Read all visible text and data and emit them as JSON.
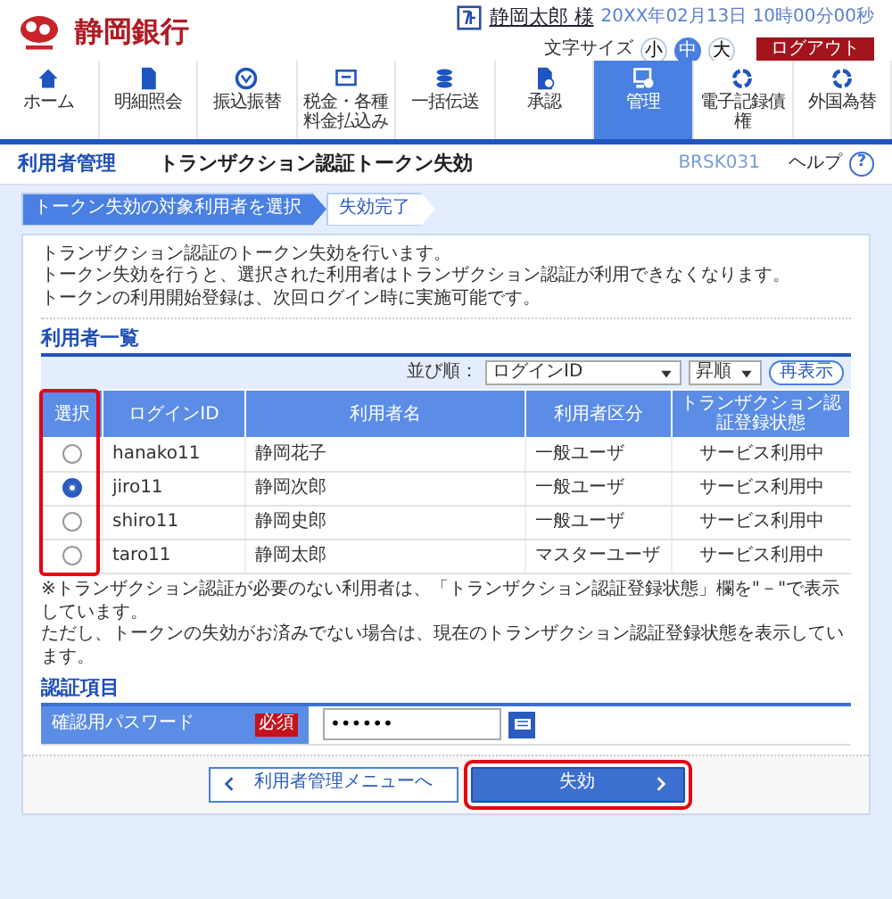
{
  "header": {
    "bank_name": "静岡銀行",
    "user_name": "静岡太郎 様",
    "datetime": "20XX年02月13日 10時00分00秒",
    "font_size_label": "文字サイズ",
    "font_sizes": [
      {
        "label": "小",
        "selected": false
      },
      {
        "label": "中",
        "selected": true
      },
      {
        "label": "大",
        "selected": false
      }
    ],
    "logout": "ログアウト"
  },
  "nav": [
    {
      "label": "ホーム",
      "kind": "home",
      "selected": false
    },
    {
      "label": "明細照会",
      "kind": "document",
      "selected": false
    },
    {
      "label": "振込振替",
      "kind": "transfer",
      "selected": false
    },
    {
      "label": "税金・各種料金払込み",
      "kind": "bill",
      "selected": false
    },
    {
      "label": "一括伝送",
      "kind": "stack",
      "selected": false
    },
    {
      "label": "承認",
      "kind": "approve",
      "selected": false
    },
    {
      "label": "管理",
      "kind": "admin",
      "selected": true
    },
    {
      "label": "電子記録債権",
      "kind": "ring",
      "selected": false
    },
    {
      "label": "外国為替",
      "kind": "ring",
      "selected": false
    }
  ],
  "page": {
    "category": "利用者管理",
    "title": "トランザクション認証トークン失効",
    "screen_id": "BRSK031",
    "help": "ヘルプ",
    "help_icon": "?"
  },
  "steps": [
    {
      "label": "トークン失効の対象利用者を選択",
      "selected": true
    },
    {
      "label": "失効完了",
      "selected": false
    }
  ],
  "intro": [
    "トランザクション認証のトークン失効を行います。",
    "トークン失効を行うと、選択された利用者はトランザクション認証が利用できなくなります。",
    "トークンの利用開始登録は、次回ログイン時に実施可能です。"
  ],
  "user_list": {
    "heading": "利用者一覧",
    "sort_label": "並び順：",
    "sort_field": "ログインID",
    "sort_order": "昇順",
    "redisplay": "再表示",
    "columns": [
      "選択",
      "ログインID",
      "利用者名",
      "利用者区分",
      "トランザクション認証登録状態"
    ],
    "select_column_highlighted": true,
    "rows": [
      {
        "login_id": "hanako11",
        "name": "静岡花子",
        "user_type": "一般ユーザ",
        "status": "サービス利用中",
        "selected": false
      },
      {
        "login_id": "jiro11",
        "name": "静岡次郎",
        "user_type": "一般ユーザ",
        "status": "サービス利用中",
        "selected": true
      },
      {
        "login_id": "shiro11",
        "name": "静岡史郎",
        "user_type": "一般ユーザ",
        "status": "サービス利用中",
        "selected": false
      },
      {
        "login_id": "taro11",
        "name": "静岡太郎",
        "user_type": "マスターユーザ",
        "status": "サービス利用中",
        "selected": false
      }
    ]
  },
  "notes": [
    "※トランザクション認証が必要のない利用者は、「トランザクション認証登録状態」欄を\"－\"で表示しています。",
    "ただし、トークンの失効がお済みでない場合は、現在のトランザクション認証登録状態を表示しています。"
  ],
  "auth": {
    "heading": "認証項目",
    "label": "確認用パスワード",
    "required": "必須",
    "value": "••••••"
  },
  "buttons": [
    {
      "label": "利用者管理メニューへ",
      "kind": "back",
      "highlighted": false
    },
    {
      "label": "失効",
      "kind": "primary",
      "highlighted": true
    }
  ]
}
